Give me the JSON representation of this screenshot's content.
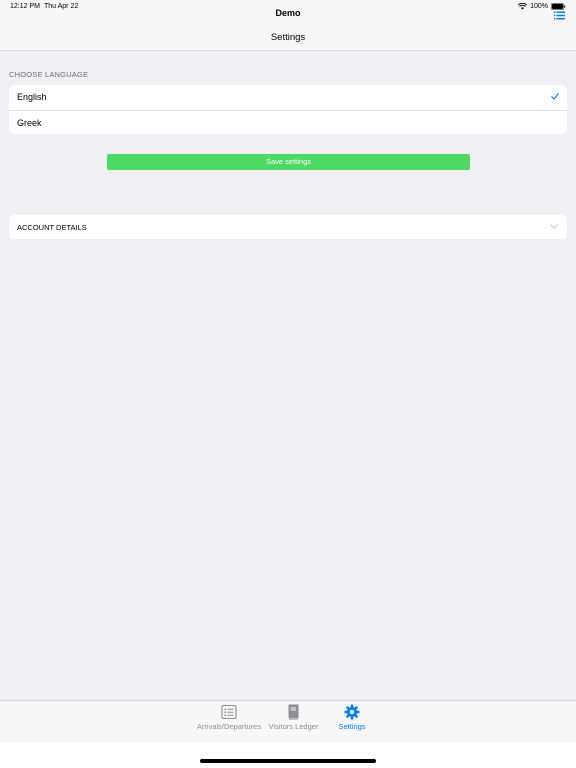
{
  "status": {
    "time": "12:12 PM",
    "date": "Thu Apr 22",
    "battery": "100%"
  },
  "app": {
    "title": "Demo"
  },
  "nav": {
    "title": "Settings"
  },
  "language": {
    "header": "CHOOSE LANGUAGE",
    "options": [
      {
        "label": "English",
        "selected": true
      },
      {
        "label": "Greek",
        "selected": false
      }
    ]
  },
  "save_button": {
    "label": "Save settings",
    "color": "#4cd964"
  },
  "account": {
    "label": "ACCOUNT DETAILS"
  },
  "tabs": [
    {
      "label": "Arrivals/Departures",
      "icon": "list-icon",
      "active": false
    },
    {
      "label": "Visitors Ledger",
      "icon": "book-icon",
      "active": false
    },
    {
      "label": "Settings",
      "icon": "gear-icon",
      "active": true
    }
  ],
  "colors": {
    "accent": "#007aff",
    "inactive": "#8e8e93",
    "background": "#efeff4"
  }
}
